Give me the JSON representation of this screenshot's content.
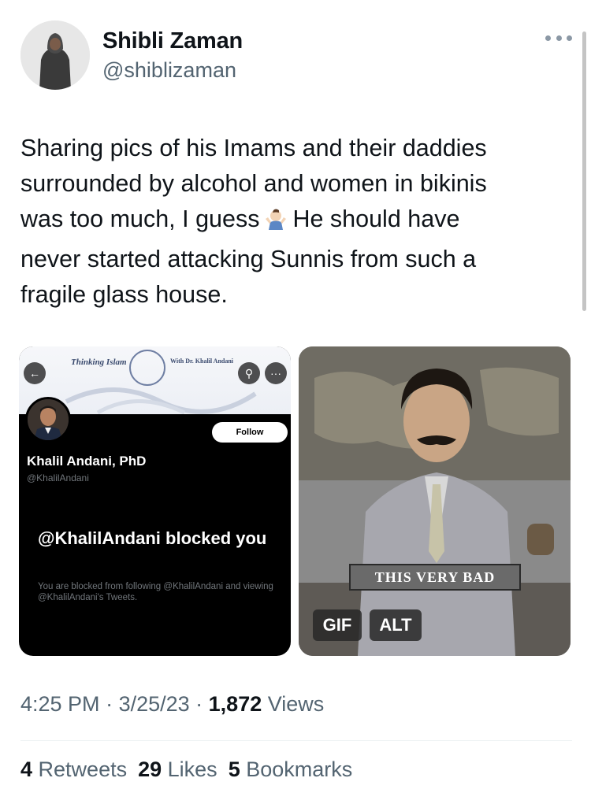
{
  "author": {
    "display_name": "Shibli Zaman",
    "handle": "@shiblizaman"
  },
  "tweet": {
    "text_line1": "Sharing pics of his Imams and their daddies",
    "text_line2": "surrounded by alcohol and women in bikinis",
    "text_line3a": "was too much, I guess",
    "text_line3b": "He should have",
    "text_line4": "never started attacking Sunnis from such a",
    "text_line5": "fragile glass house."
  },
  "screenshot": {
    "banner_title": "Thinking Islam",
    "banner_sub": "With Dr. Khalil Andani",
    "follow_label": "Follow",
    "name": "Khalil Andani, PhD",
    "handle": "@KhalilAndani",
    "blocked_title": "@KhalilAndani blocked you",
    "blocked_desc": "You are blocked from following @KhalilAndani and viewing @KhalilAndani's Tweets."
  },
  "gif": {
    "subtitle": "THIS VERY BAD",
    "gif_badge": "GIF",
    "alt_badge": "ALT"
  },
  "meta": {
    "time": "4:25 PM",
    "sep1": " · ",
    "date": "3/25/23",
    "sep2": " · ",
    "views_count": "1,872",
    "views_label": " Views"
  },
  "stats": {
    "retweets_count": "4",
    "retweets_label": " Retweets",
    "likes_count": "29",
    "likes_label": " Likes",
    "bookmarks_count": "5",
    "bookmarks_label": " Bookmarks"
  },
  "colors": {
    "text_primary": "#0f1419",
    "text_secondary": "#536471"
  }
}
